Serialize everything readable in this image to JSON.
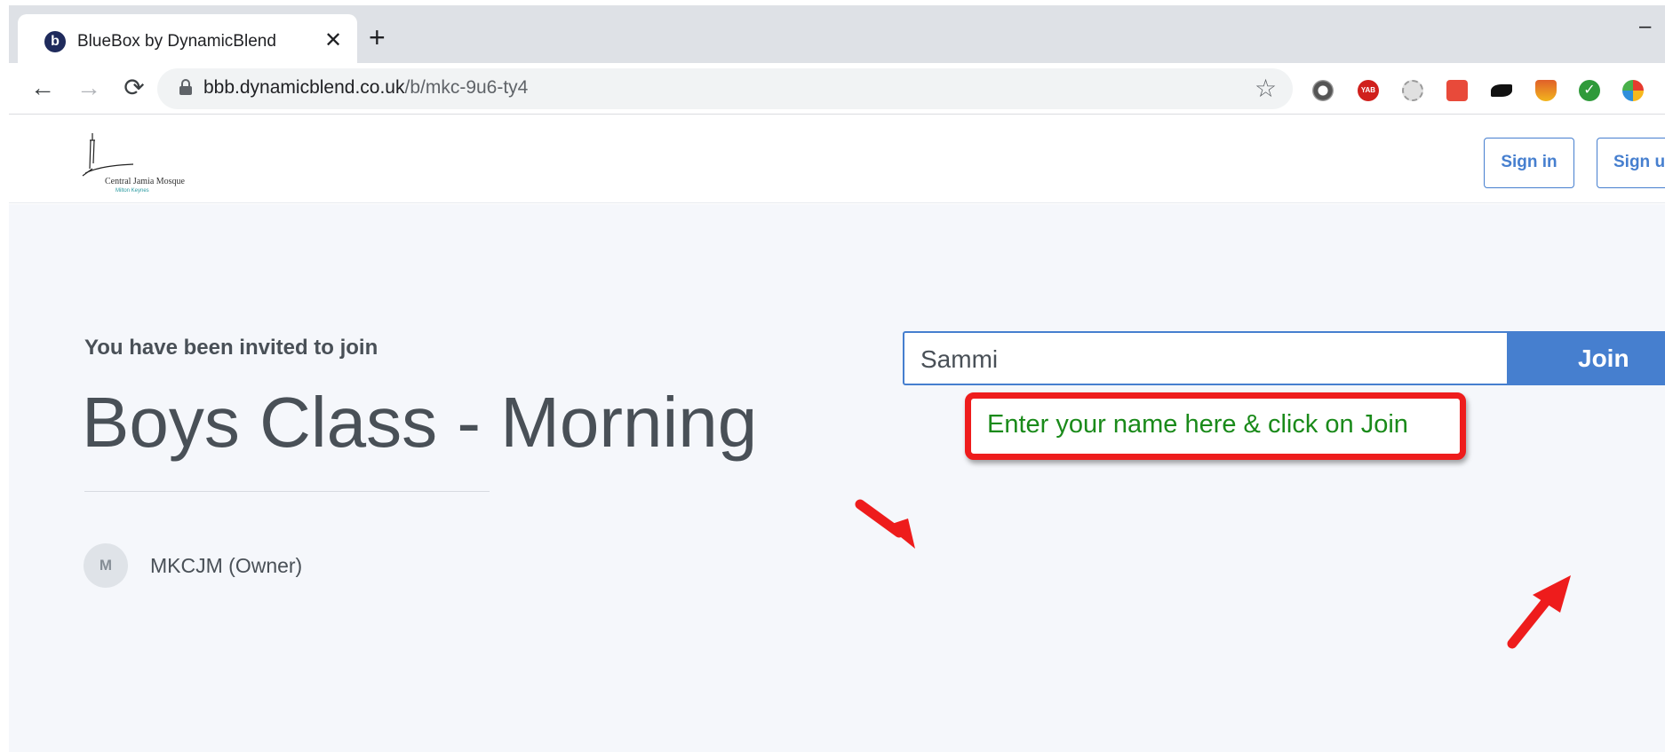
{
  "browser": {
    "tab_title": "BlueBox by DynamicBlend",
    "tab_favicon_letter": "b",
    "tab_close": "✕",
    "new_tab": "+",
    "window_minimize": "–",
    "nav": {
      "back": "←",
      "forward": "→",
      "reload": "⟳"
    },
    "url_host": "bbb.dynamicblend.co.uk",
    "url_path": "/b/mkc-9u6-ty4",
    "bookmark_star": "☆",
    "extensions": [
      "vpn-icon",
      "yab-icon",
      "extension-icon",
      "badge-icon",
      "fish-icon",
      "shield-icon",
      "checkmark-icon",
      "puzzle-flower-icon",
      "screen-icon"
    ]
  },
  "header": {
    "logo_text": "Central Jamia Mosque",
    "logo_subtext": "Milton Keynes",
    "sign_in": "Sign in",
    "sign_up": "Sign u"
  },
  "room": {
    "invite_label": "You have been invited to join",
    "title": "Boys Class - Morning",
    "owner_initial": "M",
    "owner": "MKCJM (Owner)"
  },
  "join_form": {
    "name_value": "Sammi",
    "join_label": "Join"
  },
  "annotation": {
    "callout_text": "Enter your name here & click on Join",
    "color": "#ee1c1c",
    "text_color": "#1a8a1a"
  },
  "colors": {
    "accent": "#467fcf",
    "page_bg": "#f5f7fb",
    "text": "#495057"
  }
}
